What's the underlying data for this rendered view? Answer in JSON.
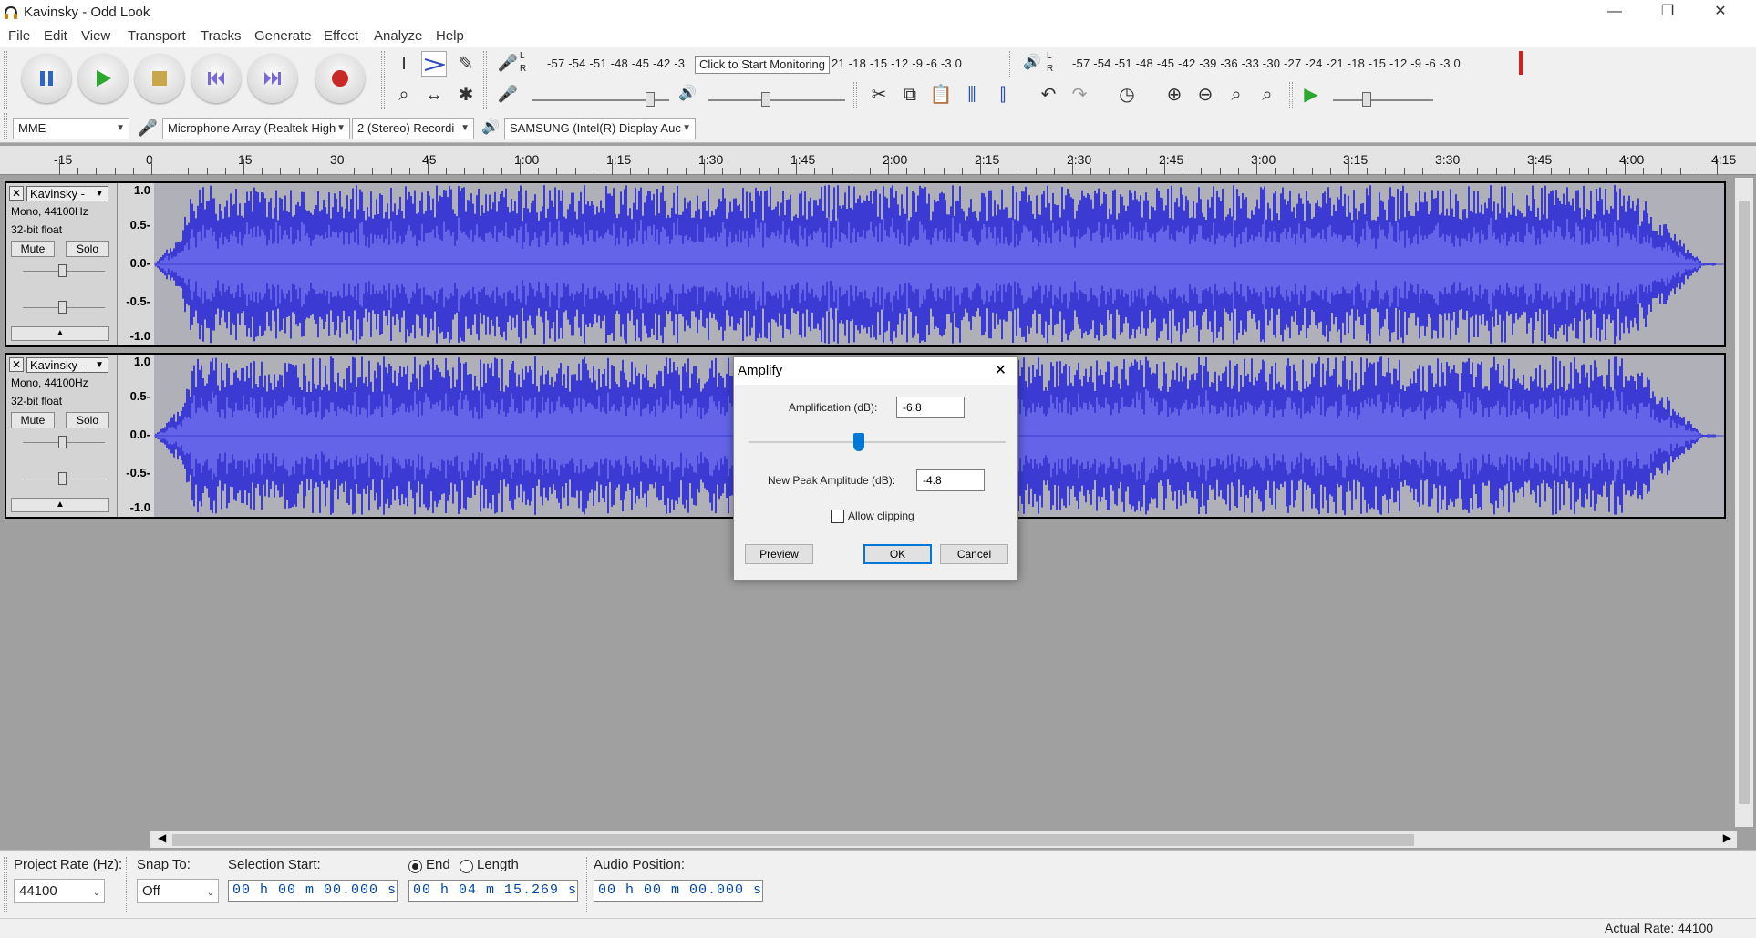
{
  "window": {
    "title": "Kavinsky - Odd Look",
    "minimize": "—",
    "restore": "❐",
    "close": "✕"
  },
  "menu": [
    "File",
    "Edit",
    "View",
    "Transport",
    "Tracks",
    "Generate",
    "Effect",
    "Analyze",
    "Help"
  ],
  "transport": {
    "pause": "Pause",
    "play": "Play",
    "stop": "Stop",
    "skip_start": "Skip to Start",
    "skip_end": "Skip to End",
    "record": "Record"
  },
  "meters": {
    "record_scale": "-57 -54 -51 -48 -45 -42 -3",
    "record_scale_right": "21 -18 -15 -12  -9  -6  -3  0",
    "monitor_hint": "Click to Start Monitoring",
    "playback_scale": "-57 -54 -51 -48 -45 -42 -39 -36 -33 -30 -27 -24 -21 -18 -15 -12  -9  -6  -3  0",
    "lr_left": "L",
    "lr_right": "R"
  },
  "device": {
    "host": "MME",
    "recording_device": "Microphone Array (Realtek High",
    "channels": "2 (Stereo) Recordi",
    "playback_device": "SAMSUNG (Intel(R) Display Auc"
  },
  "ruler": [
    "-15",
    "0",
    "15",
    "30",
    "45",
    "1:00",
    "1:15",
    "1:30",
    "1:45",
    "2:00",
    "2:15",
    "2:30",
    "2:45",
    "3:00",
    "3:15",
    "3:30",
    "3:45",
    "4:00",
    "4:15"
  ],
  "tracks": [
    {
      "name": "Kavinsky - ",
      "format": "Mono, 44100Hz",
      "bits": "32-bit float",
      "mute": "Mute",
      "solo": "Solo",
      "scale": [
        "1.0",
        "0.5-",
        "0.0-",
        "-0.5-",
        "-1.0"
      ]
    },
    {
      "name": "Kavinsky - ",
      "format": "Mono, 44100Hz",
      "bits": "32-bit float",
      "mute": "Mute",
      "solo": "Solo",
      "scale": [
        "1.0",
        "0.5-",
        "0.0-",
        "-0.5-",
        "-1.0"
      ]
    }
  ],
  "amplify": {
    "title": "Amplify",
    "amp_label": "Amplification (dB):",
    "amp_value": "-6.8",
    "amp_slider_level": 0.43,
    "peak_label": "New Peak Amplitude (dB):",
    "peak_value": "-4.8",
    "clip_label": "Allow clipping",
    "clip_checked": false,
    "preview": "Preview",
    "ok": "OK",
    "cancel": "Cancel"
  },
  "bottom": {
    "rate_label": "Project Rate (Hz):",
    "rate_value": "44100",
    "snap_label": "Snap To:",
    "snap_value": "Off",
    "sel_start_label": "Selection Start:",
    "sel_start_value": "00 h 00 m 00.000 s",
    "end_label": "End",
    "length_label": "Length",
    "end_value": "00 h 04 m 15.269 s",
    "audio_pos_label": "Audio Position:",
    "audio_pos_value": "00 h 00 m 00.000 s"
  },
  "status": {
    "actual_rate": "Actual Rate: 44100"
  },
  "colors": {
    "waveform": "#3b3bd4",
    "waveform_rms": "#6464e8",
    "accent": "#0078d7",
    "record": "#c82828",
    "play": "#2ca82c"
  }
}
